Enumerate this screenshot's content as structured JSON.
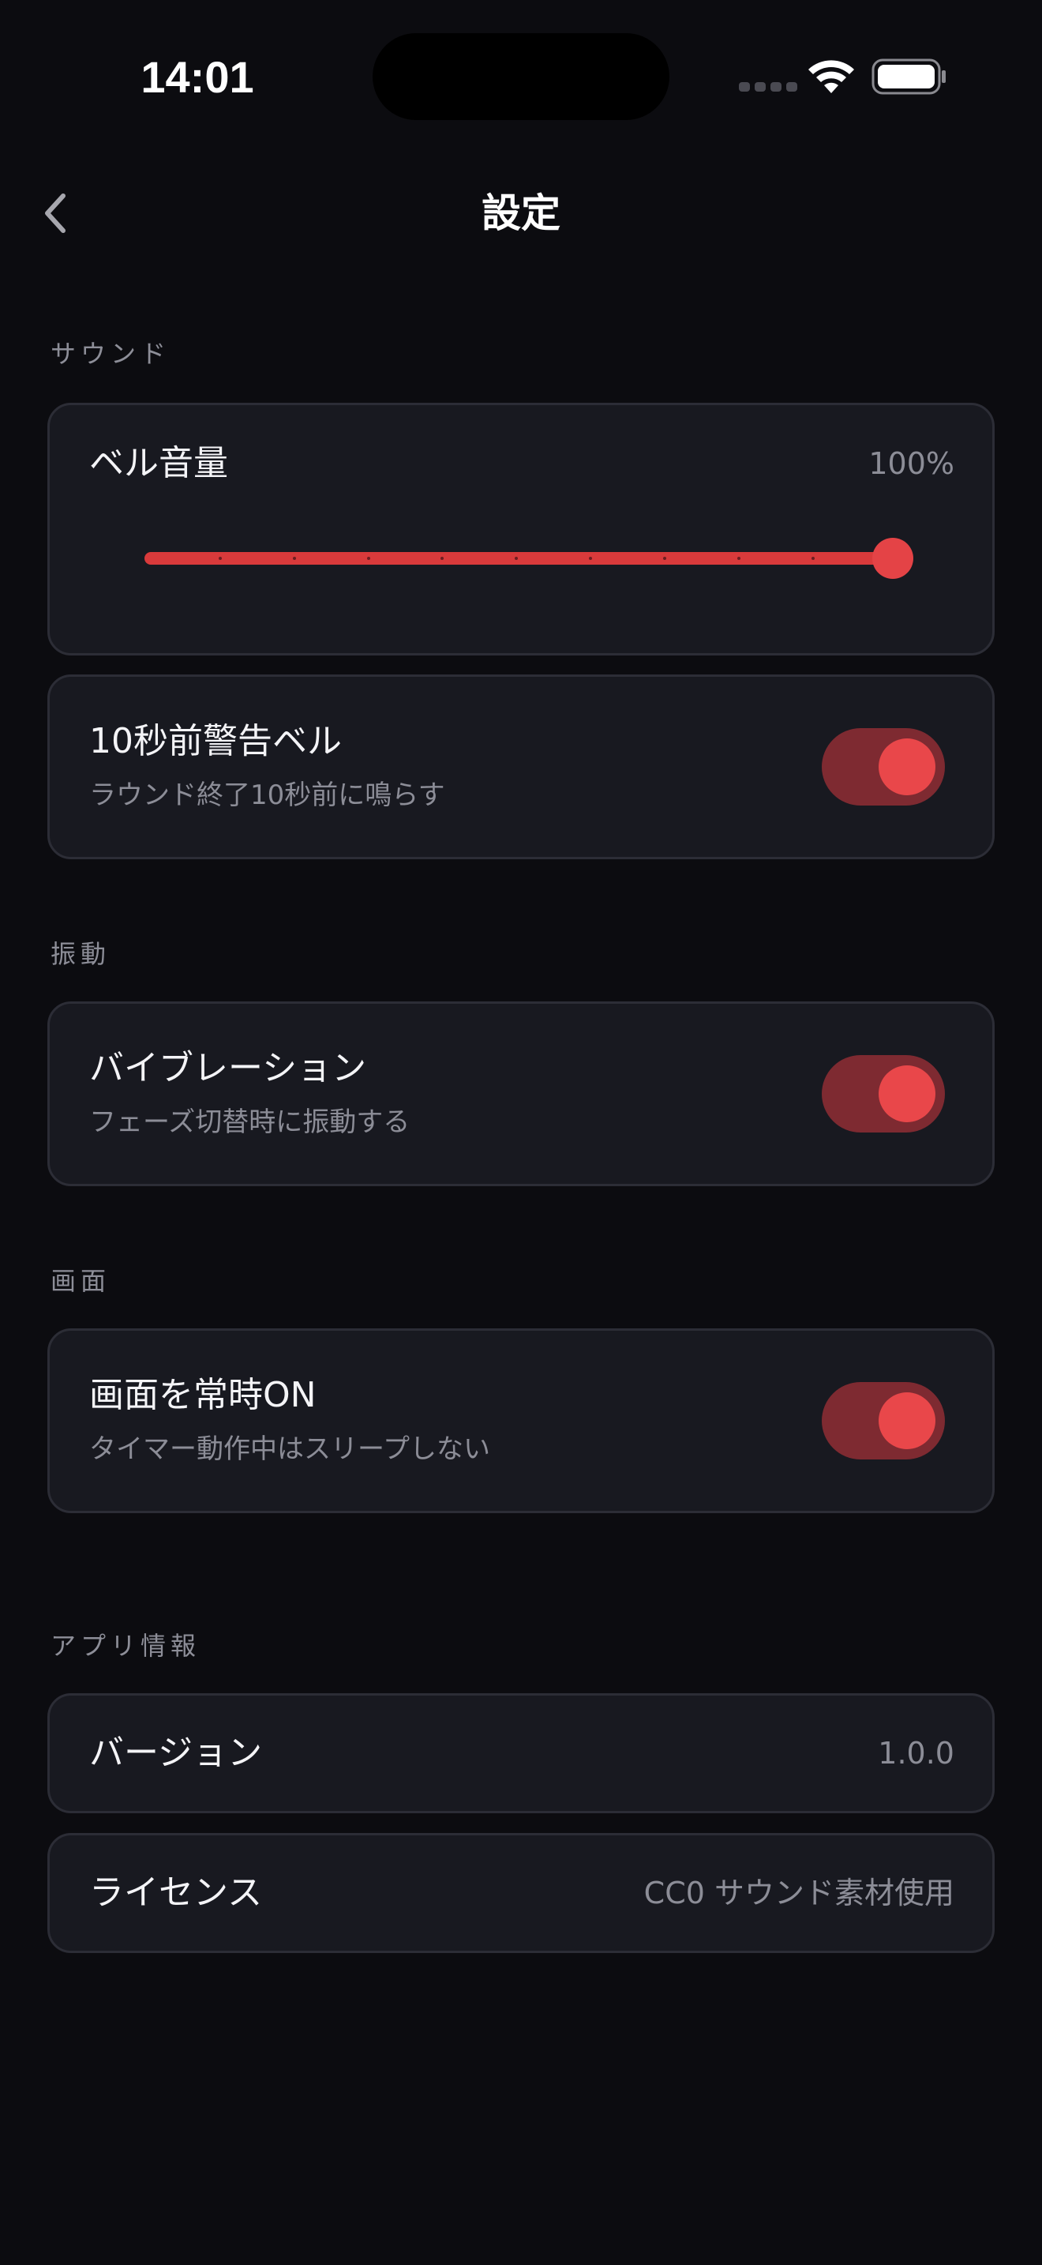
{
  "status_bar": {
    "time": "14:01"
  },
  "nav": {
    "title": "設定",
    "back_icon": "chevron-left-icon"
  },
  "sections": {
    "sound": {
      "header": "サウンド",
      "bell_volume": {
        "label": "ベル音量",
        "value_text": "100%",
        "value": 1.0
      },
      "warning_bell": {
        "label": "10秒前警告ベル",
        "description": "ラウンド終了10秒前に鳴らす",
        "enabled": true
      }
    },
    "vibration": {
      "header": "振動",
      "vibration": {
        "label": "バイブレーション",
        "description": "フェーズ切替時に振動する",
        "enabled": true
      }
    },
    "display": {
      "header": "画面",
      "always_on": {
        "label": "画面を常時ON",
        "description": "タイマー動作中はスリープしない",
        "enabled": true
      }
    },
    "app_info": {
      "header": "アプリ情報",
      "version": {
        "label": "バージョン",
        "value": "1.0.0"
      },
      "license": {
        "label": "ライセンス",
        "value": "CC0 サウンド素材使用"
      }
    }
  },
  "colors": {
    "background": "#0c0c10",
    "card": "#181920",
    "card_border": "#2c2d36",
    "accent": "#e44346",
    "toggle_track": "#7e2a31",
    "secondary_text": "#8c8d97"
  }
}
